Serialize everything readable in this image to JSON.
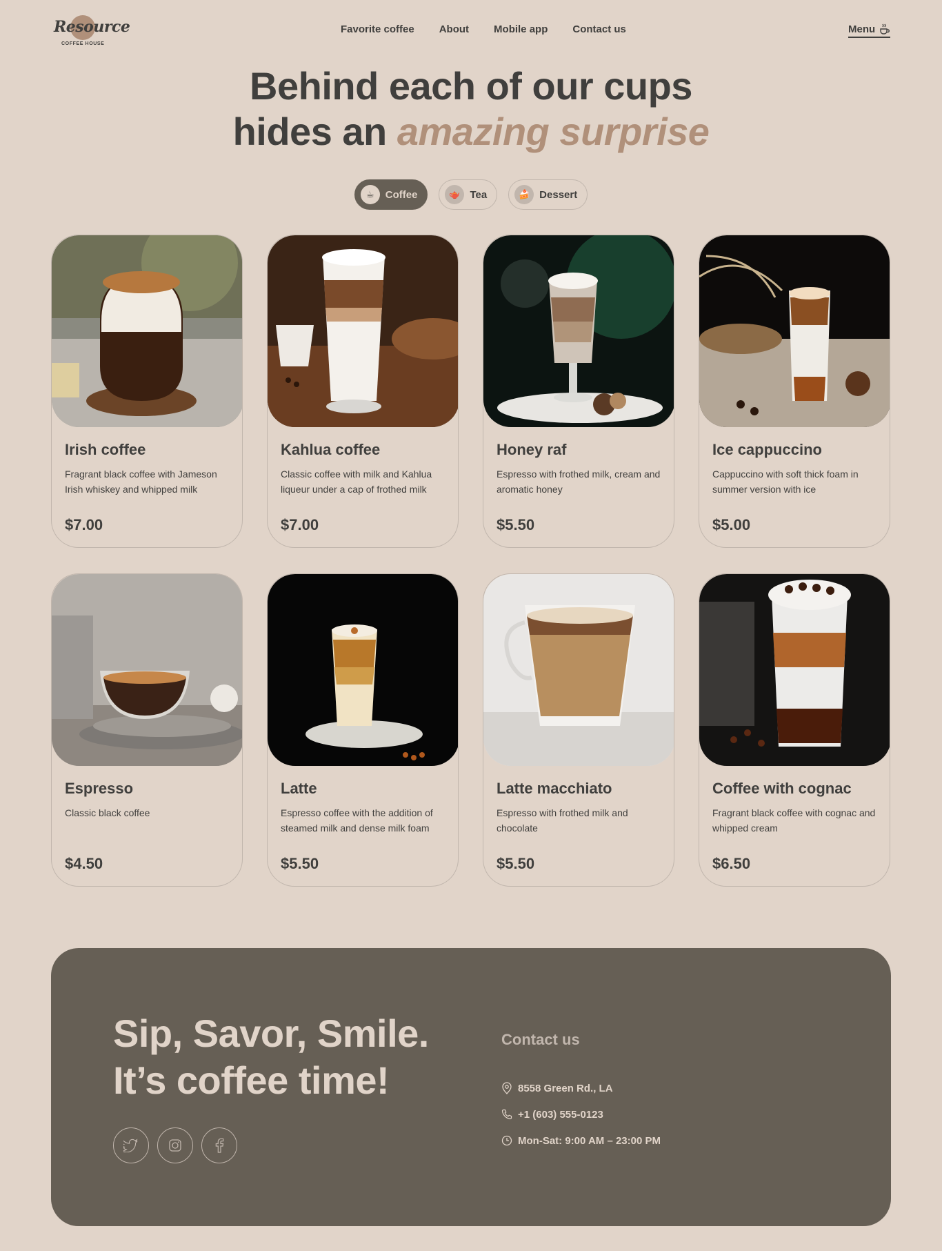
{
  "brand": {
    "name": "Resource",
    "subtitle": "COFFEE HOUSE"
  },
  "nav": [
    {
      "label": "Favorite coffee"
    },
    {
      "label": "About"
    },
    {
      "label": "Mobile app"
    },
    {
      "label": "Contact us"
    }
  ],
  "menu": {
    "label": "Menu",
    "icon": "coffee-cup-icon"
  },
  "heading": {
    "line1": "Behind each of our cups",
    "line2_plain": "hides an ",
    "line2_accent": "amazing surprise"
  },
  "tabs": [
    {
      "label": "Coffee",
      "icon": "☕",
      "active": true
    },
    {
      "label": "Tea",
      "icon": "🫖",
      "active": false
    },
    {
      "label": "Dessert",
      "icon": "🍰",
      "active": false
    }
  ],
  "products": [
    {
      "name": "Irish coffee",
      "description": "Fragrant black coffee with Jameson Irish whiskey and whipped milk",
      "price": "$7.00"
    },
    {
      "name": "Kahlua coffee",
      "description": "Classic coffee with milk and Kahlua liqueur under a cap of frothed milk",
      "price": "$7.00"
    },
    {
      "name": "Honey raf",
      "description": "Espresso with frothed milk, cream and aromatic honey",
      "price": "$5.50"
    },
    {
      "name": "Ice cappuccino",
      "description": "Cappuccino with soft thick foam in summer version with ice",
      "price": "$5.00"
    },
    {
      "name": "Espresso",
      "description": "Classic black coffee",
      "price": "$4.50"
    },
    {
      "name": "Latte",
      "description": "Espresso coffee with the addition of steamed milk and dense milk foam",
      "price": "$5.50"
    },
    {
      "name": "Latte macchiato",
      "description": "Espresso with frothed milk and chocolate",
      "price": "$5.50"
    },
    {
      "name": "Coffee with cognac",
      "description": "Fragrant black coffee with cognac and whipped cream",
      "price": "$6.50"
    }
  ],
  "footer": {
    "title_line1": "Sip, Savor, Smile.",
    "title_line2": "It’s coffee time!",
    "socials": [
      "twitter-icon",
      "instagram-icon",
      "facebook-icon"
    ],
    "contact_title": "Contact us",
    "address": "8558 Green Rd., LA",
    "phone": "+1 (603) 555-0123",
    "hours": "Mon-Sat: 9:00 AM – 23:00 PM"
  },
  "colors": {
    "background": "#e1d4c9",
    "dark": "#403f3d",
    "accent": "#b0907a",
    "footer": "#665f55",
    "border": "#c1b6ad"
  }
}
